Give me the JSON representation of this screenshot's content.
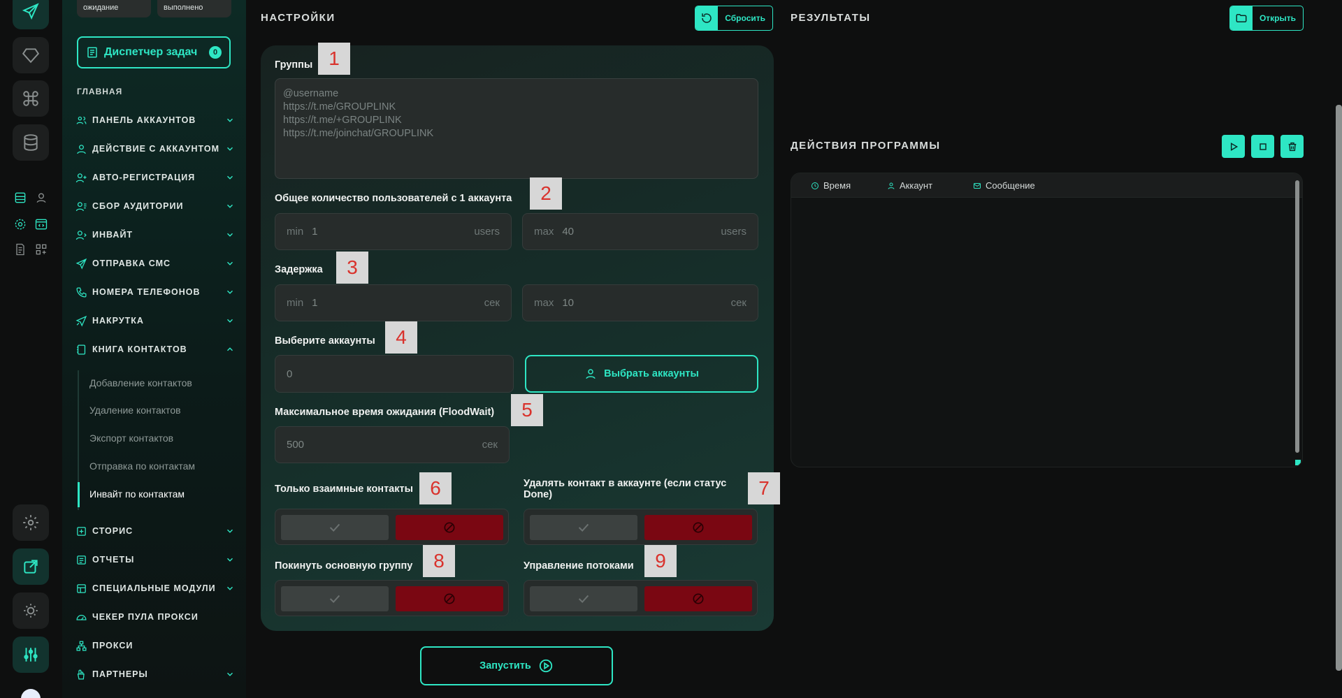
{
  "sidebar": {
    "status_chips": [
      "ожидание",
      "выполнено"
    ],
    "task_manager": {
      "label": "Диспетчер задач",
      "count": "0"
    },
    "heading": "ГЛАВНАЯ",
    "items": [
      {
        "label": "ПАНЕЛЬ АККАУНТОВ",
        "icon": "users-icon"
      },
      {
        "label": "ДЕЙСТВИЕ С АККАУНТОМ",
        "icon": "user-icon"
      },
      {
        "label": "АВТО-РЕГИСТРАЦИЯ",
        "icon": "user-plus-icon"
      },
      {
        "label": "СБОР АУДИТОРИИ",
        "icon": "audience-icon"
      },
      {
        "label": "ИНВАЙТ",
        "icon": "invite-icon"
      },
      {
        "label": "ОТПРАВКА СМС",
        "icon": "send-icon"
      },
      {
        "label": "НОМЕРА ТЕЛЕФОНОВ",
        "icon": "phone-icon"
      },
      {
        "label": "НАКРУТКА",
        "icon": "boost-icon"
      },
      {
        "label": "КНИГА КОНТАКТОВ",
        "icon": "contacts-book-icon"
      },
      {
        "label": "СТОРИС",
        "icon": "stories-icon"
      },
      {
        "label": "ОТЧЕТЫ",
        "icon": "reports-icon"
      },
      {
        "label": "СПЕЦИАЛЬНЫЕ МОДУЛИ",
        "icon": "modules-icon"
      },
      {
        "label": "ЧЕКЕР ПУЛА ПРОКСИ",
        "icon": "gauge-icon"
      },
      {
        "label": "ПРОКСИ",
        "icon": "proxy-icon"
      },
      {
        "label": "ПАРТНЕРЫ",
        "icon": "partners-icon"
      }
    ],
    "sub_items": [
      "Добавление контактов",
      "Удаление контактов",
      "Экспорт контактов",
      "Отправка по контактам",
      "Инвайт по контактам"
    ]
  },
  "settings": {
    "title": "НАСТРОЙКИ",
    "reset_label": "Сбросить",
    "groups": {
      "label": "Группы",
      "placeholder": "@username\nhttps://t.me/GROUPLINK\nhttps://t.me/+GROUPLINK\nhttps://t.me/joinchat/GROUPLINK"
    },
    "users_total": {
      "label": "Общее количество пользователей с 1 аккаунта",
      "min_prefix": "min",
      "min_value": "1",
      "max_prefix": "max",
      "max_value": "40",
      "unit": "users"
    },
    "delay": {
      "label": "Задержка",
      "min_prefix": "min",
      "min_value": "1",
      "max_prefix": "max",
      "max_value": "10",
      "unit": "сек"
    },
    "accounts": {
      "label": "Выберите аккаунты",
      "value": "0",
      "button": "Выбрать аккаунты"
    },
    "floodwait": {
      "label": "Максимальное время ожидания (FloodWait)",
      "value": "500",
      "unit": "сек"
    },
    "toggles": {
      "mutual": "Только взаимные контакты",
      "delete_contact": "Удалять контакт в аккаунте (если статус Done)",
      "leave_group": "Покинуть основную группу",
      "threads": "Управление потоками"
    },
    "run_label": "Запустить"
  },
  "markers": [
    "1",
    "2",
    "3",
    "4",
    "5",
    "6",
    "7",
    "8",
    "9"
  ],
  "results": {
    "title": "РЕЗУЛЬТАТЫ",
    "open_label": "Открыть"
  },
  "actions": {
    "title": "ДЕЙСТВИЯ ПРОГРАММЫ",
    "columns": [
      "Время",
      "Аккаунт",
      "Сообщение"
    ]
  },
  "colors": {
    "accent": "#2ee6c4",
    "danger": "#7a0712",
    "marker_text": "#d9322c"
  }
}
